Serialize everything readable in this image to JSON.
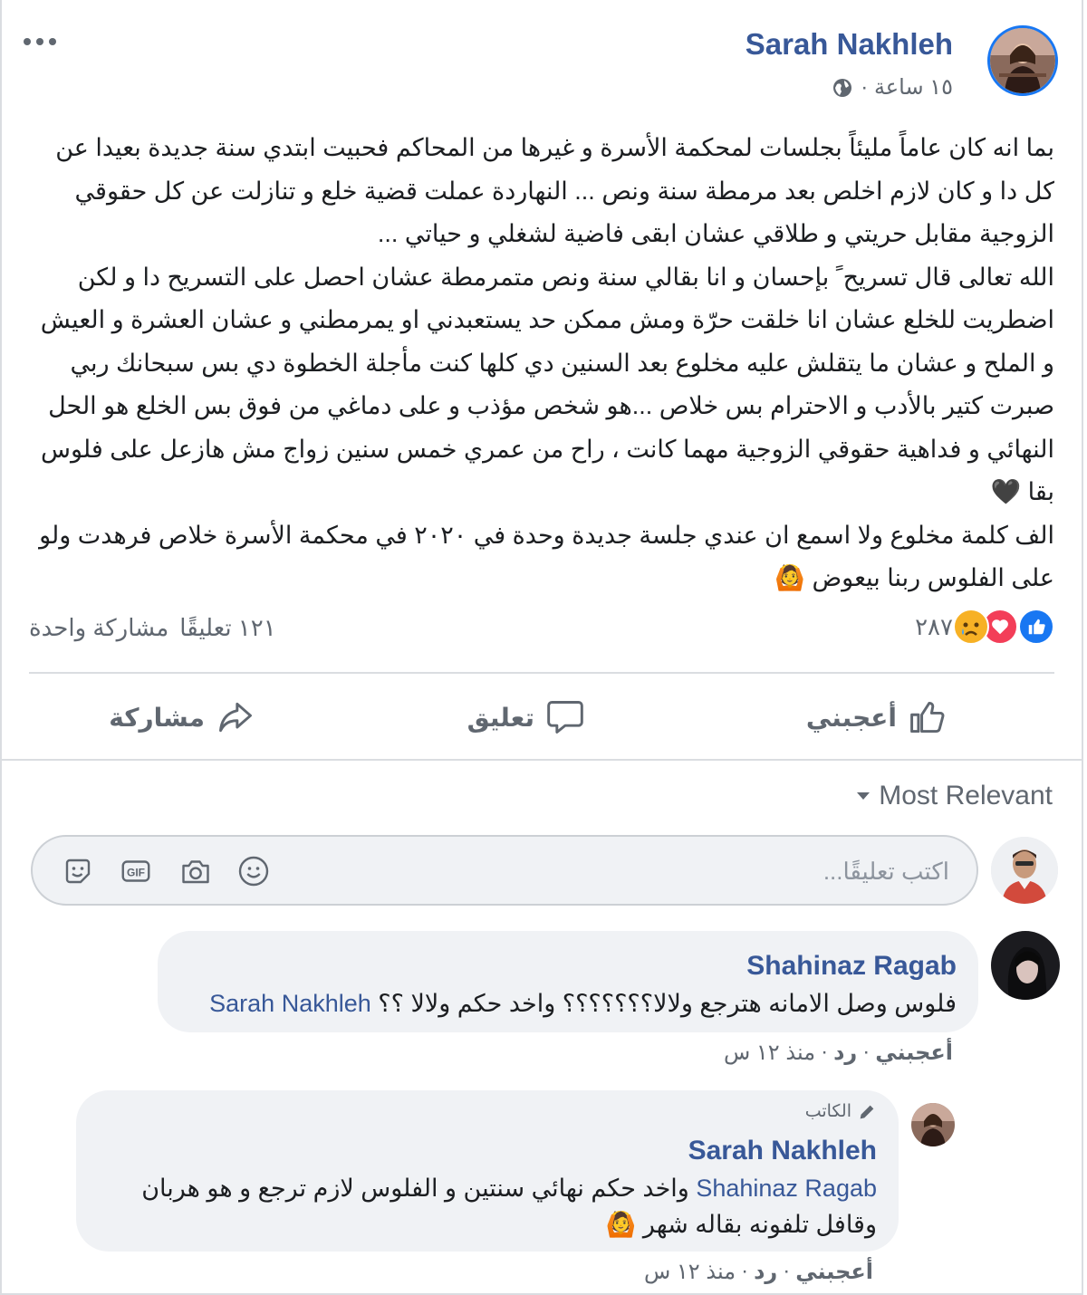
{
  "post": {
    "author": "Sarah Nakhleh",
    "time": "١٥ ساعة ·",
    "paragraphs": [
      "بما انه كان عاماً مليئاً بجلسات لمحكمة الأسرة و غيرها من المحاكم فحبيت ابتدي سنة جديدة بعيدا عن كل دا و كان لازم اخلص بعد مرمطة سنة ونص ... النهاردة عملت قضية خلع و تنازلت عن كل حقوقي الزوجية مقابل حريتي و طلاقي عشان ابقى فاضية لشغلي و حياتي ...",
      "الله تعالى قال تسريح ً بإحسان و انا بقالي سنة ونص متمرمطة عشان احصل على التسريح دا و لكن اضطريت للخلع عشان انا خلقت حرّة ومش ممكن حد يستعبدني او يمرمطني و عشان العشرة و العيش و الملح و عشان ما يتقلش عليه مخلوع بعد السنين دي كلها كنت مأجلة الخطوة دي بس سبحانك ربي صبرت كتير بالأدب و الاحترام بس خلاص ...هو شخص مؤذب و على دماغي من فوق بس الخلع هو الحل النهائي و فداهية حقوقي الزوجية مهما كانت ، راح من عمري خمس سنين زواج مش هازعل على فلوس بقا 🖤",
      "الف كلمة مخلوع ولا اسمع ان عندي جلسة جديدة وحدة في ٢٠٢٠ في محكمة الأسرة خلاص فرهدت ولو على الفلوس ربنا بيعوض 🙆"
    ],
    "reaction_count": "٢٨٧",
    "comments_count": "١٢١ تعليقًا",
    "shares_count": "مشاركة واحدة"
  },
  "actions": {
    "like": "أعجبني",
    "comment": "تعليق",
    "share": "مشاركة"
  },
  "comments_section": {
    "sort_label": "Most Relevant",
    "input_placeholder": "اكتب تعليقًا..."
  },
  "comments": [
    {
      "name": "Shahinaz Ragab",
      "text": "فلوس وصل الامانه هترجع ولالا؟؟؟؟؟؟؟ واخد حكم ولالا ؟؟",
      "mention": "Sarah Nakhleh",
      "like": "أعجبني",
      "reply": "رد",
      "time": "منذ ١٢ س"
    },
    {
      "badge": "الكاتب",
      "name": "Sarah Nakhleh",
      "mention": "Shahinaz Ragab",
      "text": "واخد حكم نهائي سنتين و الفلوس لازم ترجع و هو هربان",
      "text2": "وقافل تلفونه بقاله شهر 🙆",
      "like": "أعجبني",
      "reply": "رد",
      "time": "منذ ١٢ س"
    }
  ],
  "colors": {
    "link": "#385898",
    "like": "#1877f2",
    "love": "#f33e58",
    "sad": "#f7b125",
    "muted": "#606770"
  }
}
